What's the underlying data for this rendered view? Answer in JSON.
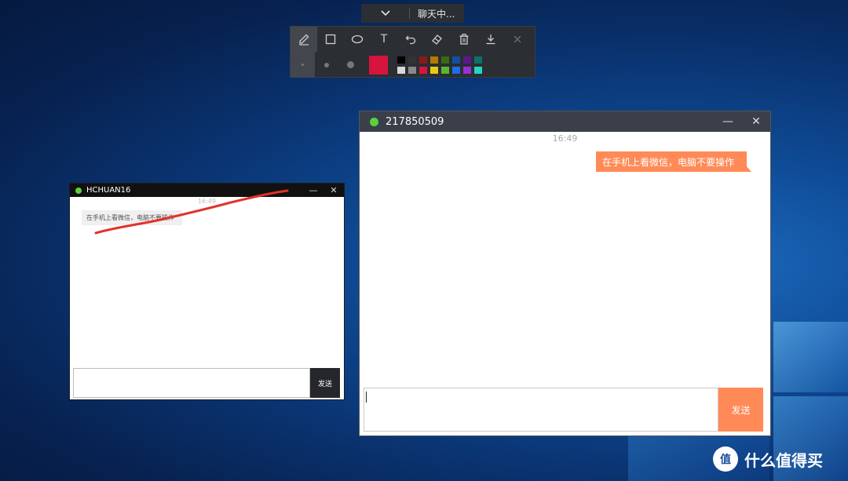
{
  "status_bar": {
    "label": "聊天中..."
  },
  "toolbar": {
    "tools": [
      "pen-icon",
      "rectangle-icon",
      "ellipse-icon",
      "text-icon",
      "undo-icon",
      "eraser-icon",
      "trash-icon",
      "download-icon",
      "close-icon"
    ],
    "text_tool_glyph": "T",
    "current_color": "#d7143e",
    "palette": [
      "#000000",
      "#333333",
      "#8b1a1a",
      "#b87800",
      "#3a6b12",
      "#1450a0",
      "#5a1a8a",
      "#0f6f6a",
      "#d9d9d9",
      "#888888",
      "#d7143e",
      "#e8c81a",
      "#5ab82a",
      "#1f6ee8",
      "#9a2fd8",
      "#22d6c2"
    ]
  },
  "small_window": {
    "title": "HCHUAN16",
    "time": "16:49",
    "message": "在手机上看微信，电脑不要操作",
    "minimize": "—",
    "close": "✕",
    "send_label": "发送"
  },
  "large_window": {
    "title": "217850509",
    "time": "16:49",
    "message": "在手机上看微信，电脑不要操作",
    "minimize": "—",
    "close": "✕",
    "send_label": "发送"
  },
  "watermark": {
    "text": "什么值得买",
    "logo_glyph": "值"
  }
}
